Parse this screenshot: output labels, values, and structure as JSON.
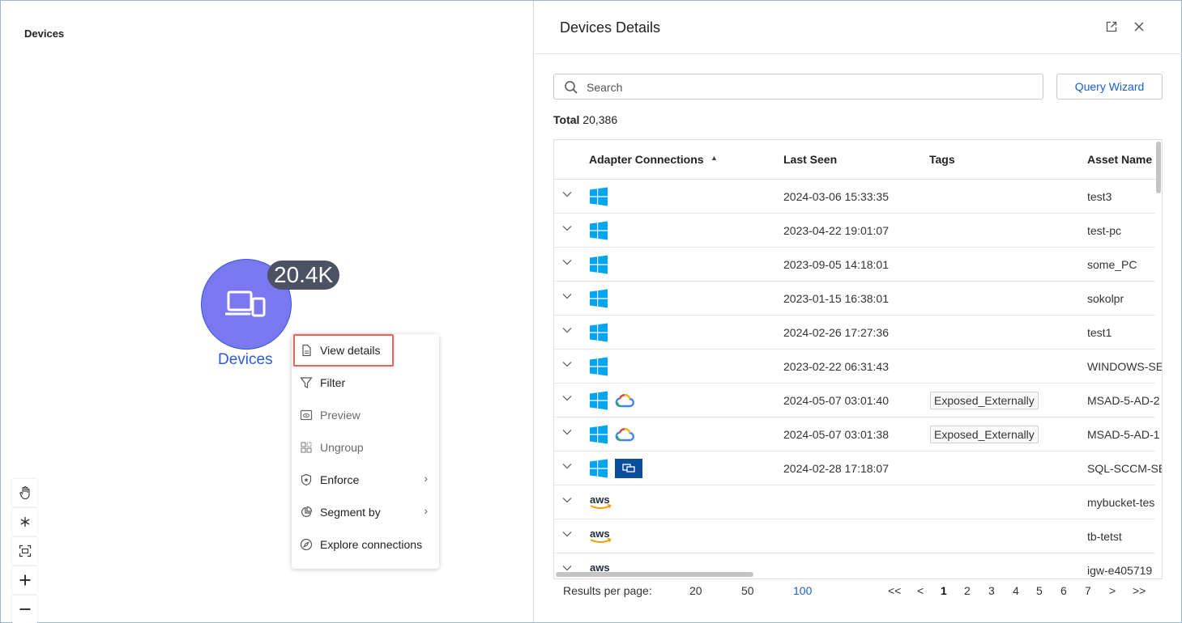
{
  "canvas": {
    "title": "Devices",
    "node": {
      "label": "Devices",
      "count_badge": "20.4K",
      "color": "#7b78ef"
    },
    "context_menu": {
      "items": [
        {
          "label": "View details",
          "icon": "document-icon",
          "enabled": true,
          "highlighted": true
        },
        {
          "label": "Filter",
          "icon": "filter-icon",
          "enabled": true
        },
        {
          "label": "Preview",
          "icon": "preview-icon",
          "enabled": false
        },
        {
          "label": "Ungroup",
          "icon": "ungroup-icon",
          "enabled": false
        },
        {
          "label": "Enforce",
          "icon": "shield-icon",
          "enabled": true,
          "submenu": true
        },
        {
          "label": "Segment by",
          "icon": "pie-chart-icon",
          "enabled": true,
          "submenu": true
        },
        {
          "label": "Explore connections",
          "icon": "compass-icon",
          "enabled": true
        }
      ]
    },
    "tools": [
      "hand-icon",
      "snowflake-icon",
      "fit-screen-icon",
      "plus-icon",
      "minus-icon"
    ]
  },
  "panel": {
    "title": "Devices Details",
    "search_placeholder": "Search",
    "query_wizard_label": "Query Wizard",
    "total_label": "Total",
    "total_value": "20,386",
    "columns": [
      "Adapter Connections",
      "Last Seen",
      "Tags",
      "Asset Name"
    ],
    "sort_indicator": "▲",
    "rows": [
      {
        "adapters": [
          "windows"
        ],
        "last_seen": "2024-03-06 15:33:35",
        "tag": "",
        "asset_name": "test3"
      },
      {
        "adapters": [
          "windows"
        ],
        "last_seen": "2023-04-22 19:01:07",
        "tag": "",
        "asset_name": "test-pc"
      },
      {
        "adapters": [
          "windows"
        ],
        "last_seen": "2023-09-05 14:18:01",
        "tag": "",
        "asset_name": "some_PC"
      },
      {
        "adapters": [
          "windows"
        ],
        "last_seen": "2023-01-15 16:38:01",
        "tag": "",
        "asset_name": "sokolpr"
      },
      {
        "adapters": [
          "windows"
        ],
        "last_seen": "2024-02-26 17:27:36",
        "tag": "",
        "asset_name": "test1"
      },
      {
        "adapters": [
          "windows"
        ],
        "last_seen": "2023-02-22 06:31:43",
        "tag": "",
        "asset_name": "WINDOWS-SE"
      },
      {
        "adapters": [
          "windows",
          "gcp"
        ],
        "last_seen": "2024-05-07 03:01:40",
        "tag": "Exposed_Externally",
        "asset_name": "MSAD-5-AD-2"
      },
      {
        "adapters": [
          "windows",
          "gcp"
        ],
        "last_seen": "2024-05-07 03:01:38",
        "tag": "Exposed_Externally",
        "asset_name": "MSAD-5-AD-1"
      },
      {
        "adapters": [
          "windows",
          "sccm"
        ],
        "last_seen": "2024-02-28 17:18:07",
        "tag": "",
        "asset_name": "SQL-SCCM-SE"
      },
      {
        "adapters": [
          "aws"
        ],
        "last_seen": "",
        "tag": "",
        "asset_name": "mybucket-tes"
      },
      {
        "adapters": [
          "aws"
        ],
        "last_seen": "",
        "tag": "",
        "asset_name": "tb-tetst"
      },
      {
        "adapters": [
          "aws"
        ],
        "last_seen": "",
        "tag": "",
        "asset_name": "igw-e405719"
      }
    ],
    "footer": {
      "results_per_page_label": "Results per page:",
      "page_sizes": [
        "20",
        "50",
        "100"
      ],
      "active_page_size": "100",
      "pagination": [
        "<<",
        "<",
        "1",
        "2",
        "3",
        "4",
        "5",
        "6",
        "7",
        ">",
        ">>"
      ],
      "current_page": "1"
    }
  },
  "colors": {
    "accent": "#1a5fc9",
    "highlight_border": "#e06a5d",
    "windows_blue": "#00a4ef",
    "aws_orange": "#ff9900"
  }
}
